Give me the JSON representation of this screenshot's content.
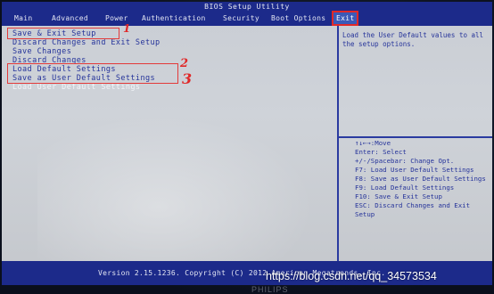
{
  "window": {
    "title": "BIOS Setup Utility"
  },
  "tabs": [
    {
      "label": "Main"
    },
    {
      "label": "Advanced"
    },
    {
      "label": "Power"
    },
    {
      "label": "Authentication"
    },
    {
      "label": "Security"
    },
    {
      "label": "Boot Options"
    },
    {
      "label": "Exit",
      "active": true
    }
  ],
  "menu": {
    "items": [
      {
        "label": "Save & Exit Setup"
      },
      {
        "label": "Discard Changes and Exit Setup"
      },
      {
        "label": "Save Changes"
      },
      {
        "label": "Discard Changes"
      },
      {
        "label": "Load Default Settings"
      },
      {
        "label": "Save as User Default Settings"
      },
      {
        "label": "Load User Default Settings"
      }
    ]
  },
  "annotations": {
    "n1": "1",
    "n2": "2",
    "n3": "3"
  },
  "help": {
    "description": "Load the User Default values to all the setup options.",
    "keys": [
      "↑↓←→:Move",
      "Enter: Select",
      "+/-/Spacebar: Change Opt.",
      "F7: Load User Default Settings",
      "F8: Save as User Default Settings",
      "F9: Load Default Settings",
      "F10: Save & Exit Setup",
      "ESC: Discard Changes and Exit Setup"
    ]
  },
  "footer": {
    "version": "Version 2.15.1236. Copyright (C) 2012 American Megatrends, Inc."
  },
  "watermark": "https://blog.csdn.net/qq_34573534",
  "brand": "PHILIPS",
  "colors": {
    "bios_blue": "#1c2a8a",
    "screen_gray": "#c9cdd4",
    "text_blue": "#25339a",
    "annotation_red": "#e02828"
  }
}
